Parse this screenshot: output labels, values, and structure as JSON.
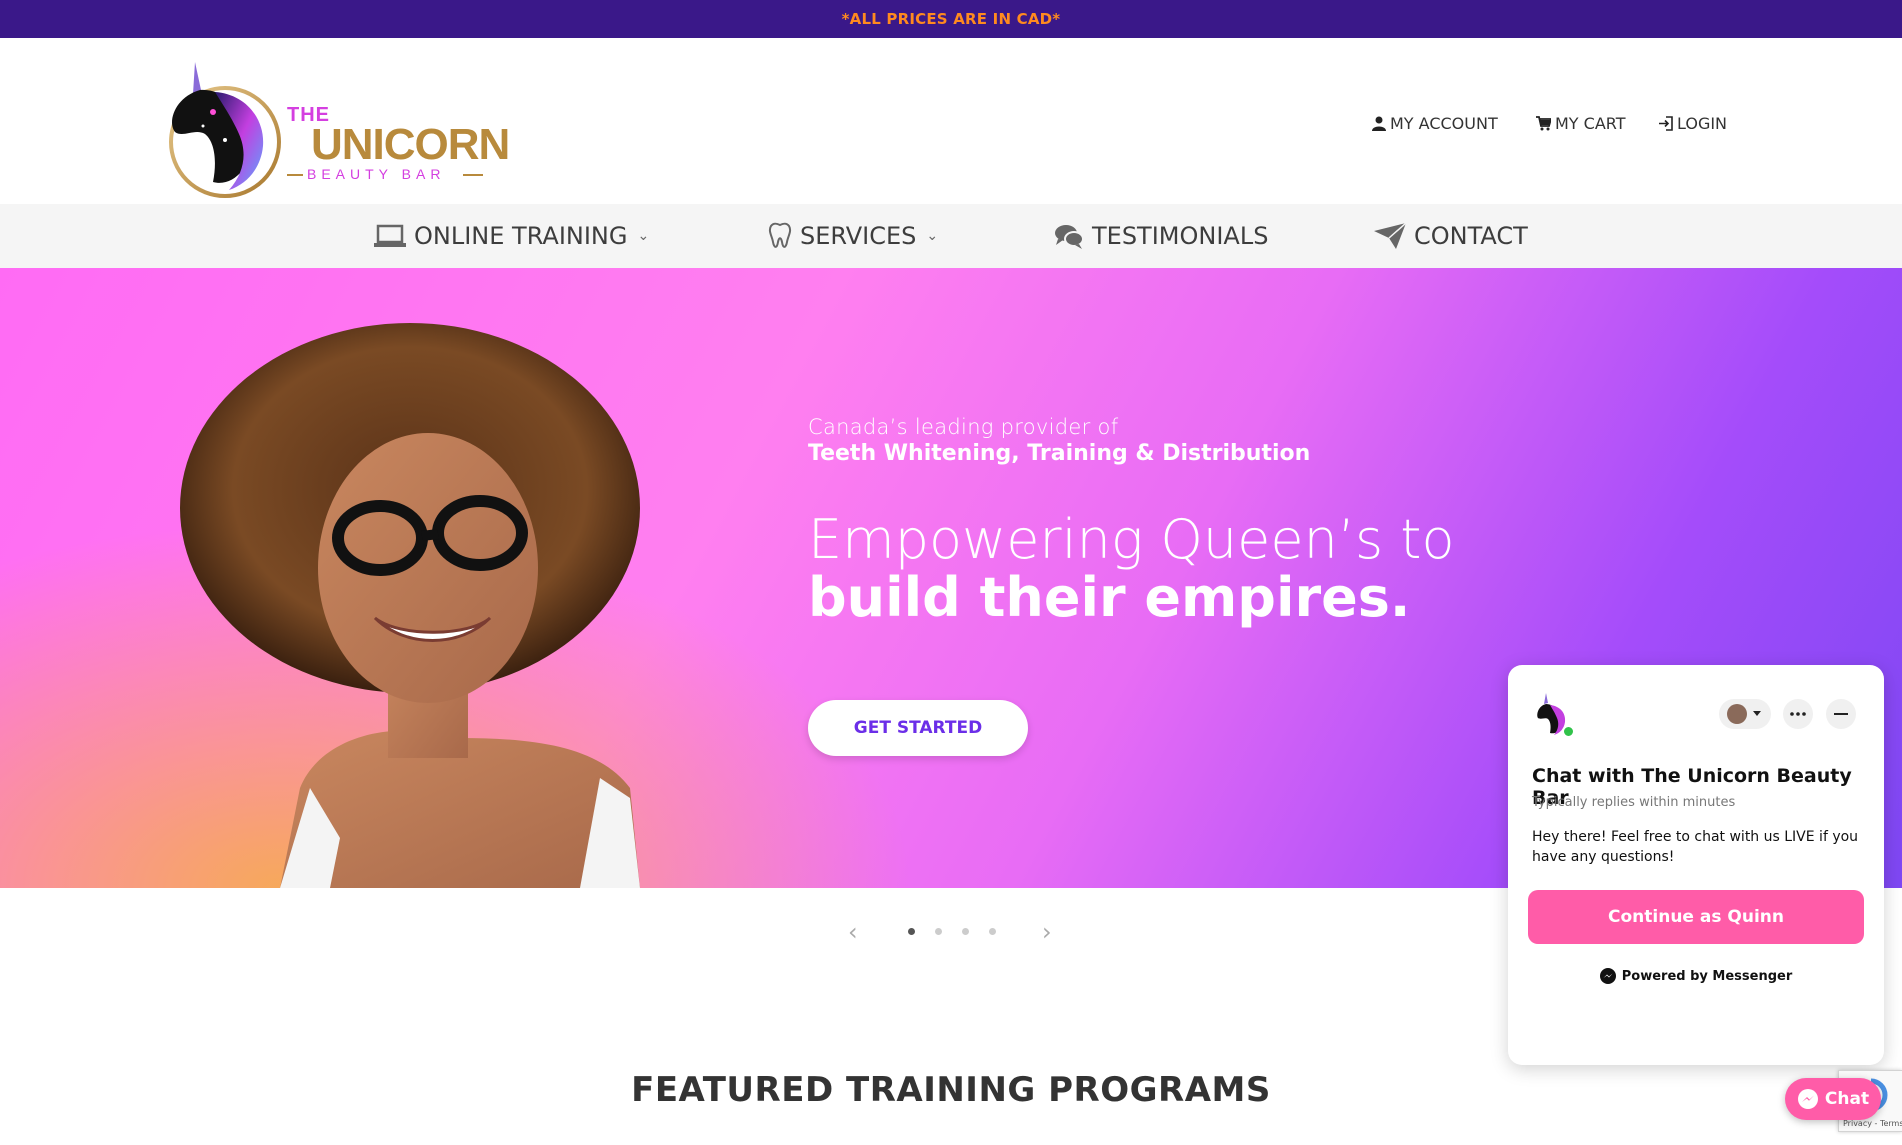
{
  "topbar": {
    "notice": "*ALL PRICES ARE IN CAD*",
    "notice_color": "#ff8a1f",
    "bg_color": "#3a1889"
  },
  "logo": {
    "the": "THE",
    "unicorn": "UNICORN",
    "beauty_bar": "BEAUTY BAR"
  },
  "account_links": [
    {
      "label": "MY ACCOUNT",
      "icon": "user-icon"
    },
    {
      "label": "MY CART",
      "icon": "cart-icon"
    },
    {
      "label": "LOGIN",
      "icon": "login-icon"
    }
  ],
  "nav": [
    {
      "label": "ONLINE TRAINING",
      "icon": "laptop-icon",
      "has_dropdown": true
    },
    {
      "label": "SERVICES",
      "icon": "tooth-icon",
      "has_dropdown": true
    },
    {
      "label": "TESTIMONIALS",
      "icon": "chat-bubbles-icon",
      "has_dropdown": false
    },
    {
      "label": "CONTACT",
      "icon": "paper-plane-icon",
      "has_dropdown": false
    }
  ],
  "hero": {
    "kicker": "Canada’s leading provider of",
    "kicker_bold": "Teeth Whitening, Training & Distribution",
    "headline_light": "Empowering Queen’s to",
    "headline_bold": "build their empires.",
    "cta": "GET STARTED",
    "accent_color": "#6b2ee8"
  },
  "carousel": {
    "slide_count": 4,
    "active_index": 0
  },
  "featured": {
    "title": "FEATURED TRAINING PROGRAMS"
  },
  "chat_panel": {
    "title": "Chat with The Unicorn Beauty Bar",
    "subtitle": "Typically replies within minutes",
    "message": "Hey there! Feel free to chat with us LIVE if you have any questions!",
    "button": "Continue as Quinn",
    "powered_by": "Powered by Messenger",
    "button_color": "#ff5ca8"
  },
  "recaptcha": {
    "text": "Privacy - Terms"
  },
  "chat_button": {
    "label": "Chat"
  }
}
